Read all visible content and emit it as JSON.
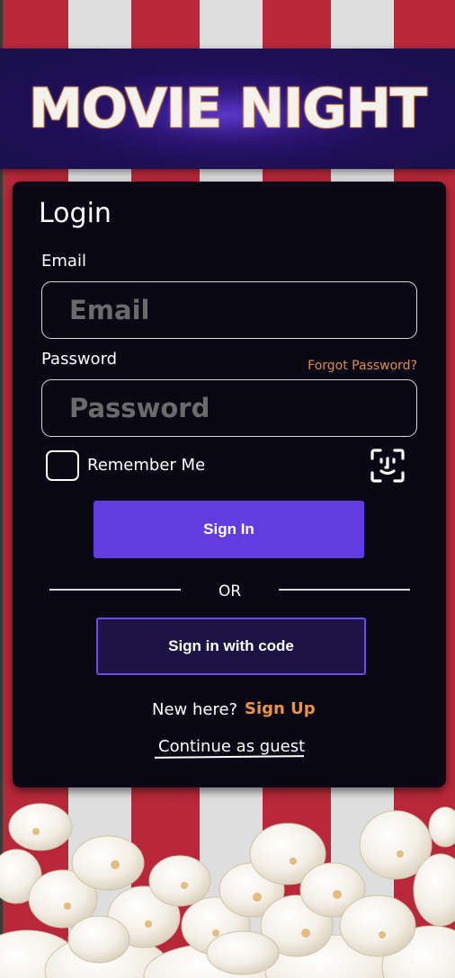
{
  "banner": {
    "title": "MOVIE NIGHT"
  },
  "login": {
    "title": "Login",
    "email_label": "Email",
    "email_placeholder": "Email",
    "password_label": "Password",
    "password_placeholder": "Password",
    "forgot_password": "Forgot Password?",
    "remember_me": "Remember Me",
    "sign_in": "Sign In",
    "or": "OR",
    "sign_in_with_code": "Sign in with code",
    "new_here": "New here?",
    "sign_up": "Sign Up",
    "continue_as_guest": "Continue as guest"
  },
  "icons": {
    "biometric": "face-id-icon",
    "decoration": "popcorn"
  },
  "colors": {
    "stripe_red": "#b8283a",
    "stripe_white": "#dedede",
    "banner_bg": "#1e0f57",
    "card_bg": "#0b0816",
    "primary_button": "#623ce1",
    "accent_orange": "#e8924b",
    "code_button_bg": "#1d1445"
  }
}
